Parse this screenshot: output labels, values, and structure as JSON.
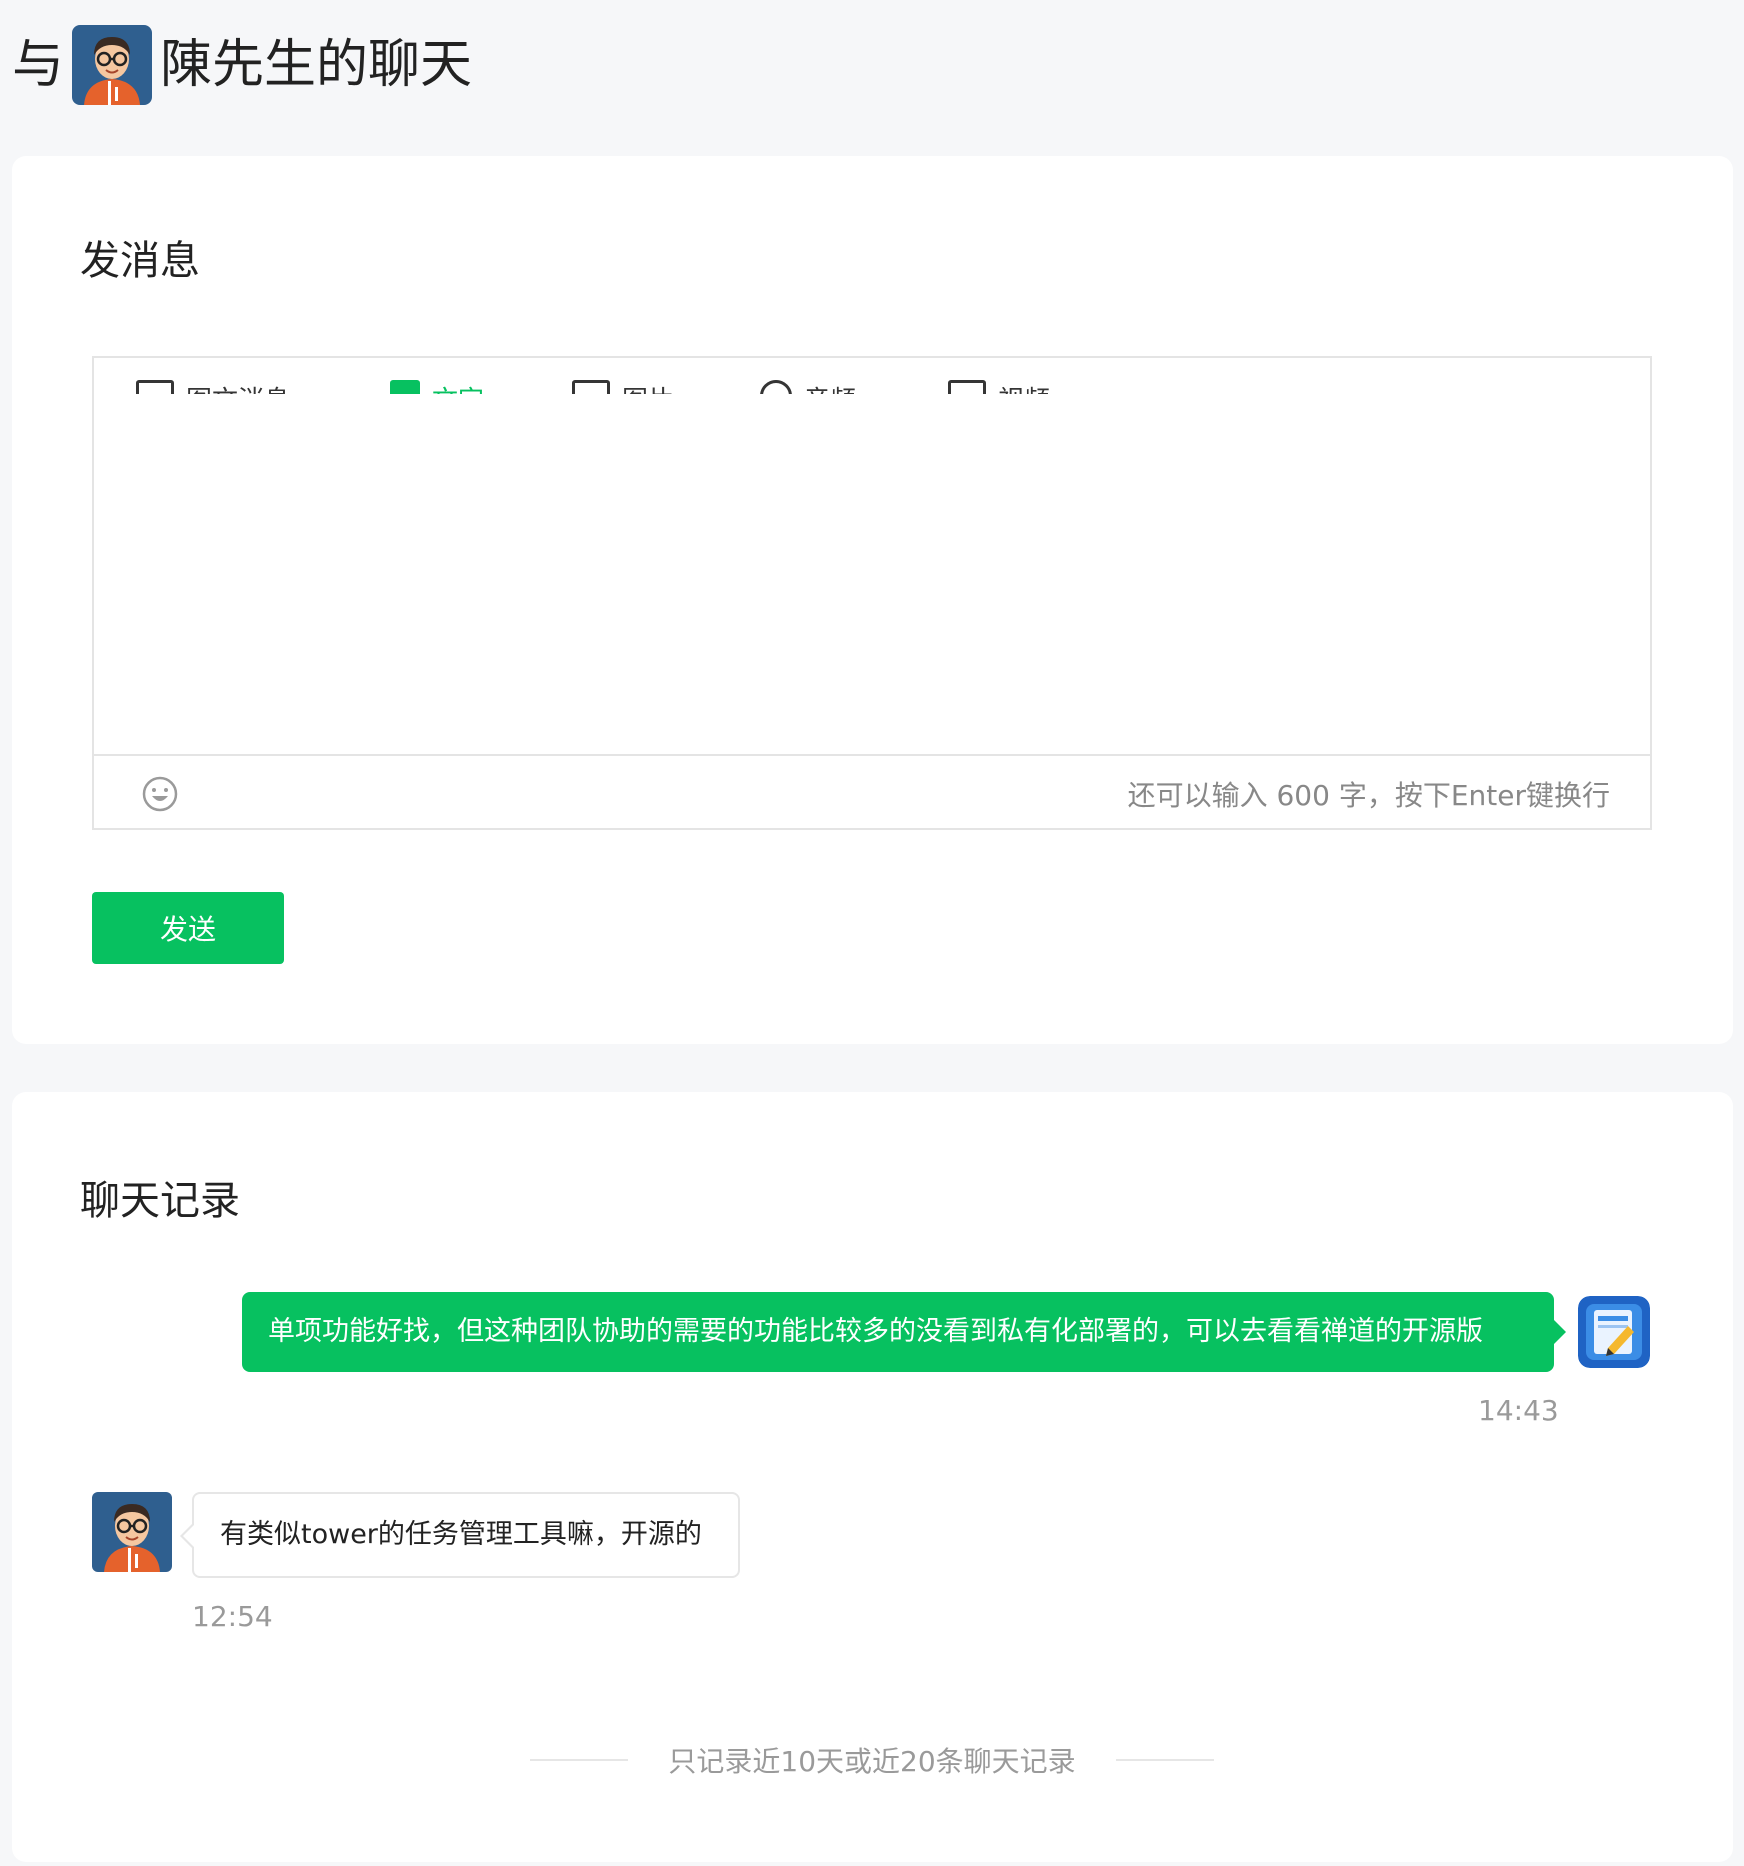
{
  "header": {
    "prefix": "与",
    "contact_name": "陳先生的聊天"
  },
  "send_section": {
    "title": "发消息",
    "tabs": [
      {
        "label": "图文消息",
        "icon": "article-icon",
        "active": false
      },
      {
        "label": "文字",
        "icon": "text-icon",
        "active": true
      },
      {
        "label": "图片",
        "icon": "image-icon",
        "active": false
      },
      {
        "label": "音频",
        "icon": "audio-icon",
        "active": false
      },
      {
        "label": "视频",
        "icon": "video-icon",
        "active": false
      }
    ],
    "input_value": "",
    "counter": "还可以输入 600 字，按下Enter键换行",
    "send_label": "发送"
  },
  "history_section": {
    "title": "聊天记录",
    "messages": [
      {
        "direction": "out",
        "text": "单项功能好找，但这种团队协助的需要的功能比较多的没看到私有化部署的，可以去看看禅道的开源版",
        "time": "14:43"
      },
      {
        "direction": "in",
        "text": "有类似tower的任务管理工具嘛，开源的",
        "time": "12:54"
      }
    ],
    "note": "只记录近10天或近20条聊天记录"
  },
  "colors": {
    "accent": "#07c160",
    "page_bg": "#f6f7f9",
    "muted": "#9a9a9a"
  }
}
